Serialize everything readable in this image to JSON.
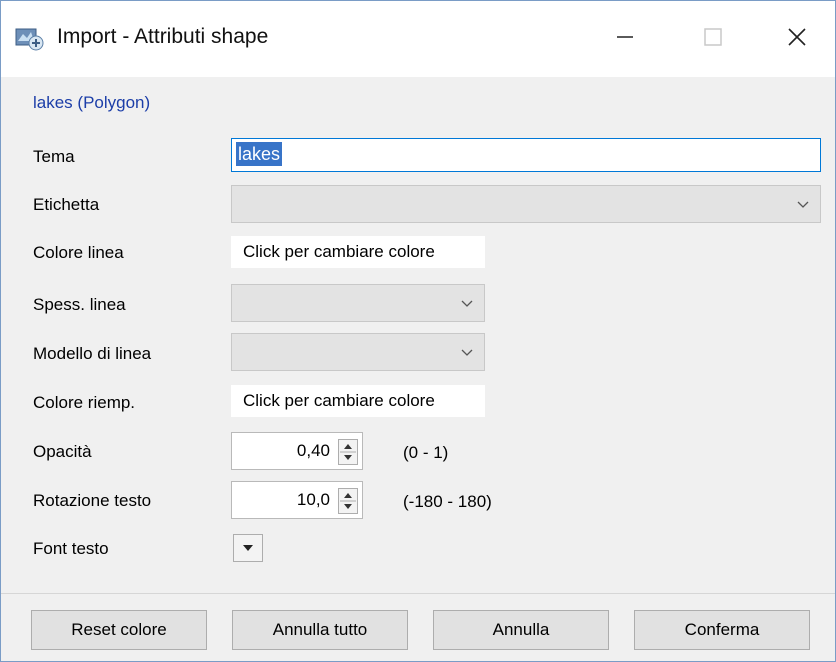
{
  "window": {
    "title": "Import - Attributi shape",
    "icon": "map-import-icon",
    "controls": {
      "minimize": "—",
      "maximize": "☐",
      "close": "✕"
    }
  },
  "layer": "lakes (Polygon)",
  "fields": {
    "tema": {
      "label": "Tema",
      "value": "lakes"
    },
    "etichetta": {
      "label": "Etichetta",
      "value": ""
    },
    "colore_linea": {
      "label": "Colore linea",
      "value": "Click per cambiare colore"
    },
    "spess_linea": {
      "label": "Spess. linea",
      "value": ""
    },
    "modello_linea": {
      "label": "Modello di linea",
      "value": ""
    },
    "colore_riemp": {
      "label": "Colore riemp.",
      "value": "Click per cambiare colore"
    },
    "opacita": {
      "label": "Opacità",
      "value": "0,40",
      "range": "(0 - 1)"
    },
    "rotazione": {
      "label": "Rotazione testo",
      "value": "10,0",
      "range": "(-180 - 180)"
    },
    "font": {
      "label": "Font testo"
    }
  },
  "buttons": {
    "reset": "Reset colore",
    "annulla_tutto": "Annulla tutto",
    "annulla": "Annulla",
    "conferma": "Conferma"
  },
  "colors": {
    "accent": "#0078d7",
    "layer_link": "#1c3ea8",
    "selection": "#3874c8"
  }
}
